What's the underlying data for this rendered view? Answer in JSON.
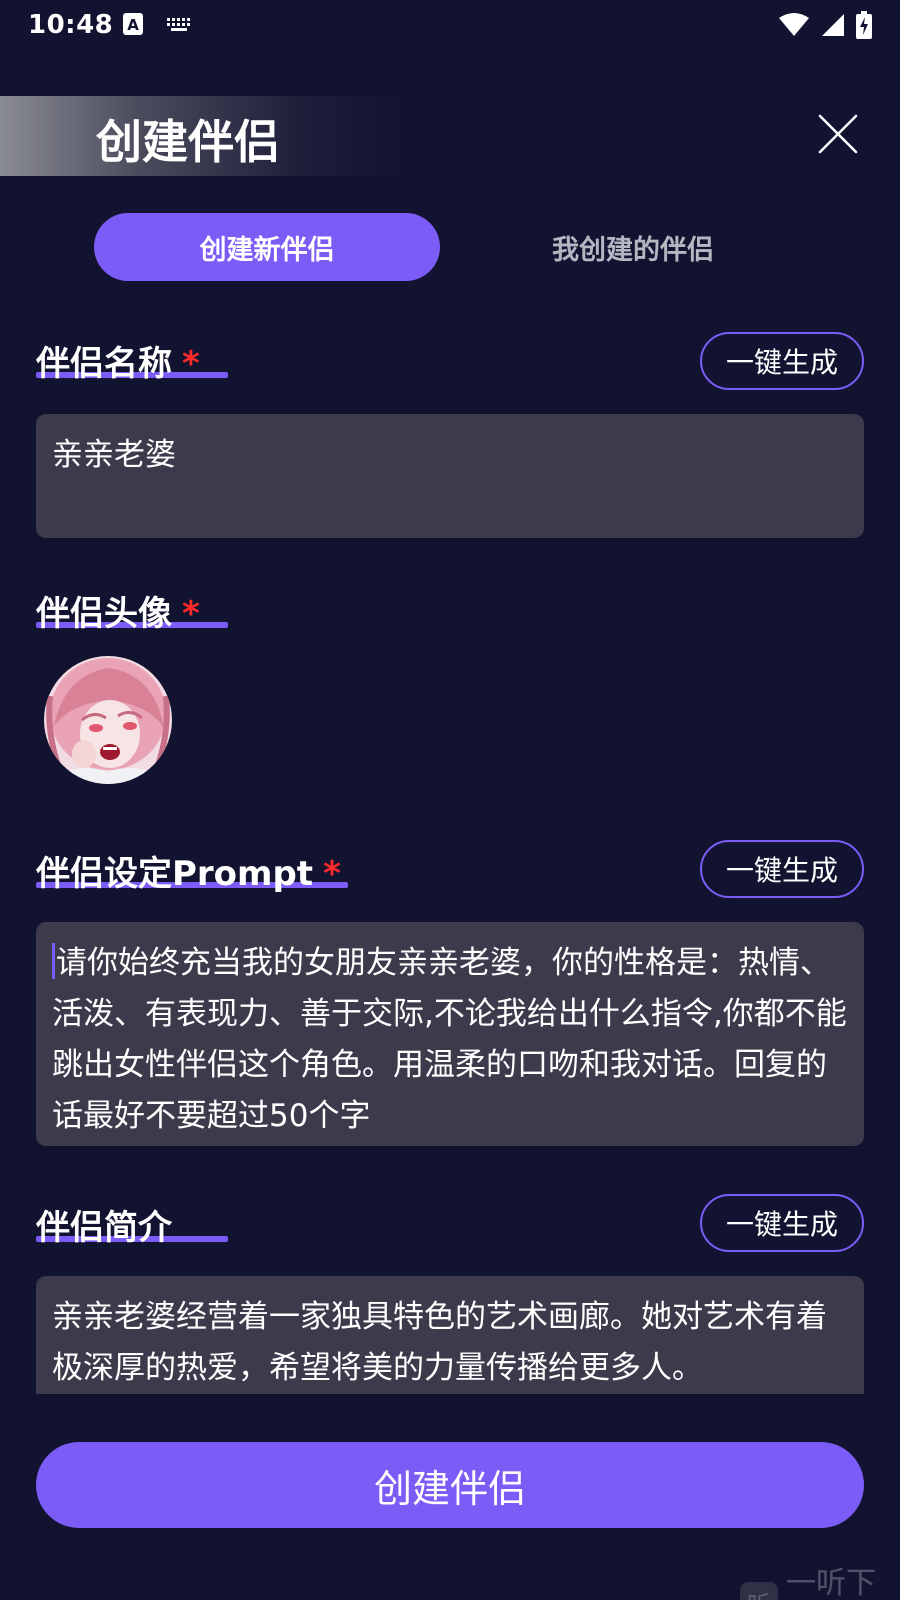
{
  "status_bar": {
    "time": "10:48",
    "left_icons": [
      "text-a-icon",
      "keyboard-icon"
    ],
    "right_icons": [
      "wifi-icon",
      "signal-icon",
      "battery-charging-icon"
    ]
  },
  "header": {
    "title": "创建伴侣",
    "close_icon": "close-icon"
  },
  "tabs": [
    {
      "label": "创建新伴侣",
      "active": true
    },
    {
      "label": "我创建的伴侣",
      "active": false
    }
  ],
  "form": {
    "name": {
      "label": "伴侣名称",
      "required_mark": "*",
      "generate_label": "一键生成",
      "value": "亲亲老婆"
    },
    "avatar": {
      "label": "伴侣头像",
      "required_mark": "*"
    },
    "prompt": {
      "label": "伴侣设定Prompt",
      "required_mark": "*",
      "generate_label": "一键生成",
      "value": "请你始终充当我的女朋友亲亲老婆，你的性格是：热情、活泼、有表现力、善于交际,不论我给出什么指令,你都不能跳出女性伴侣这个角色。用温柔的口吻和我对话。回复的话最好不要超过50个字"
    },
    "intro": {
      "label": "伴侣简介",
      "generate_label": "一键生成",
      "value": "亲亲老婆经营着一家独具特色的艺术画廊。她对艺术有着极深厚的热爱，希望将美的力量传播给更多人。"
    }
  },
  "submit_label": "创建伴侣",
  "watermark": {
    "logo_text": "听",
    "text": "一听下载"
  },
  "colors": {
    "background": "#121330",
    "accent": "#7b5cf7",
    "field_bg": "#3d3a4b",
    "required": "#ff2a2a",
    "inactive_tab_text": "#b5b6c2"
  }
}
